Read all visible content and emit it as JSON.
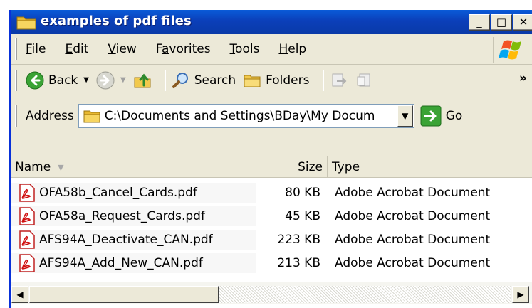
{
  "window": {
    "title": "examples of pdf files",
    "controls": {
      "minimize": "_",
      "maximize": "□",
      "close": "✕"
    }
  },
  "menu": {
    "items": [
      {
        "label": "File",
        "accel": "F"
      },
      {
        "label": "Edit",
        "accel": "E"
      },
      {
        "label": "View",
        "accel": "V"
      },
      {
        "label": "Favorites",
        "accel": "a"
      },
      {
        "label": "Tools",
        "accel": "T"
      },
      {
        "label": "Help",
        "accel": "H"
      }
    ]
  },
  "toolbar": {
    "back_label": "Back",
    "search_label": "Search",
    "folders_label": "Folders",
    "overflow": "»"
  },
  "address": {
    "label": "Address",
    "value": "C:\\Documents and Settings\\BDay\\My Docum",
    "go_label": "Go"
  },
  "list": {
    "columns": [
      "Name",
      "Size",
      "Type"
    ],
    "rows": [
      {
        "name": "OFA58b_Cancel_Cards.pdf",
        "size": "80 KB",
        "type": "Adobe Acrobat Document"
      },
      {
        "name": "OFA58a_Request_Cards.pdf",
        "size": "45 KB",
        "type": "Adobe Acrobat Document"
      },
      {
        "name": "AFS94A_Deactivate_CAN.pdf",
        "size": "223 KB",
        "type": "Adobe Acrobat Document"
      },
      {
        "name": "AFS94A_Add_New_CAN.pdf",
        "size": "213 KB",
        "type": "Adobe Acrobat Document"
      }
    ]
  },
  "colors": {
    "titlebar": "#0a48c8",
    "window_face": "#ece9d8",
    "pdf_red": "#d01010"
  }
}
